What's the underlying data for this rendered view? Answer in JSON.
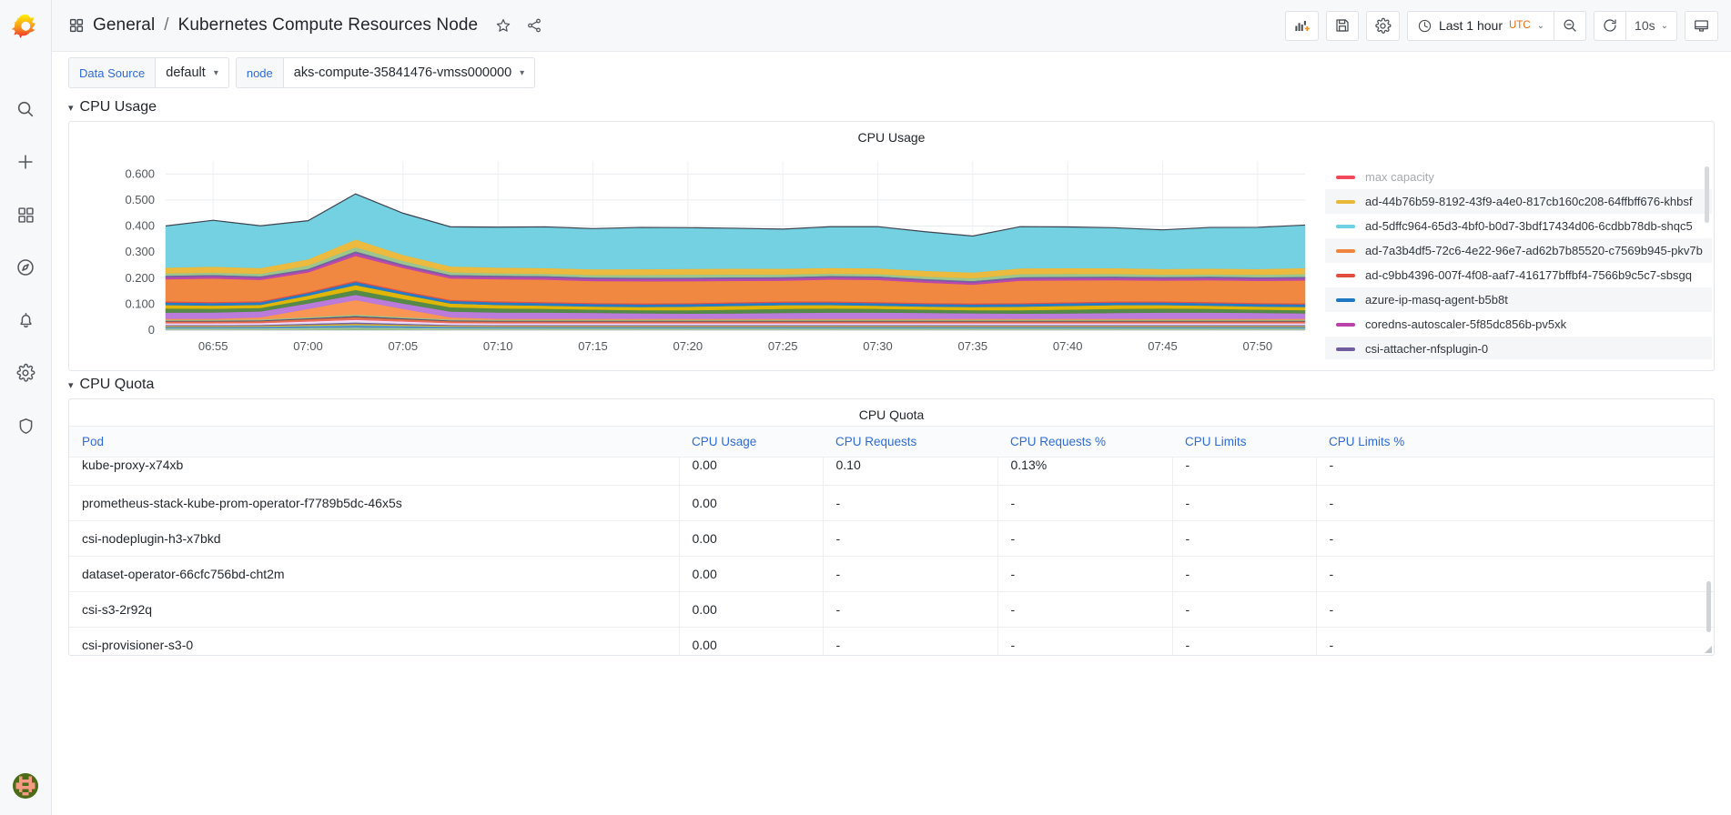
{
  "brand": {
    "icon": "grafana-logo-icon"
  },
  "sidebar": {
    "items": [
      {
        "name": "search",
        "icon": "search-icon",
        "label": "Search"
      },
      {
        "name": "create",
        "icon": "plus-icon",
        "label": "Create"
      },
      {
        "name": "dashboards",
        "icon": "dashboards-grid-icon",
        "label": "Dashboards"
      },
      {
        "name": "explore",
        "icon": "compass-icon",
        "label": "Explore"
      },
      {
        "name": "alerting",
        "icon": "bell-icon",
        "label": "Alerting"
      },
      {
        "name": "configuration",
        "icon": "gear-icon",
        "label": "Configuration"
      },
      {
        "name": "server-admin",
        "icon": "shield-icon",
        "label": "Server Admin"
      }
    ],
    "avatar": {
      "name": "user-avatar",
      "label": "User profile"
    }
  },
  "navbar": {
    "dashboard_icon": "dashboard-grid-icon",
    "folder": "General",
    "separator": "/",
    "title": "Kubernetes Compute Resources Node",
    "star_icon": "star-outline-icon",
    "share_icon": "share-nodes-icon",
    "buttons": {
      "add_panel": "add-panel-icon",
      "save": "save-disk-icon",
      "settings": "gear-icon",
      "zoom_out": "zoom-out-magnifier-icon",
      "kiosk": "tv-monitor-icon"
    },
    "time_picker": {
      "clock_icon": "clock-icon",
      "range": "Last 1 hour",
      "timezone": "UTC",
      "caret": "⌄"
    },
    "refresh": {
      "icon": "refresh-circular-arrows-icon",
      "interval": "10s",
      "caret": "⌄"
    }
  },
  "variables": [
    {
      "label": "Data Source",
      "value": "default",
      "name": "datasource"
    },
    {
      "label": "node",
      "value": "aks-compute-35841476-vmss000000",
      "name": "node"
    }
  ],
  "rows": [
    {
      "title": "CPU Usage",
      "collapsed": false
    },
    {
      "title": "CPU Quota",
      "collapsed": false
    }
  ],
  "cpu_usage_panel": {
    "title": "CPU Usage",
    "legend_scrollbar": true
  },
  "cpu_quota_panel": {
    "title": "CPU Quota",
    "columns": [
      "Pod",
      "CPU Usage",
      "CPU Requests",
      "CPU Requests %",
      "CPU Limits",
      "CPU Limits %"
    ],
    "rows": [
      {
        "pod": "kube-proxy-x74xb",
        "cpu_usage": "0.00",
        "cpu_requests": "0.10",
        "cpu_requests_pct": "0.13%",
        "cpu_limits": "-",
        "cpu_limits_pct": "-",
        "clipped": true
      },
      {
        "pod": "prometheus-stack-kube-prom-operator-f7789b5dc-46x5s",
        "cpu_usage": "0.00",
        "cpu_requests": "-",
        "cpu_requests_pct": "-",
        "cpu_limits": "-",
        "cpu_limits_pct": "-"
      },
      {
        "pod": "csi-nodeplugin-h3-x7bkd",
        "cpu_usage": "0.00",
        "cpu_requests": "-",
        "cpu_requests_pct": "-",
        "cpu_limits": "-",
        "cpu_limits_pct": "-"
      },
      {
        "pod": "dataset-operator-66cfc756bd-cht2m",
        "cpu_usage": "0.00",
        "cpu_requests": "-",
        "cpu_requests_pct": "-",
        "cpu_limits": "-",
        "cpu_limits_pct": "-"
      },
      {
        "pod": "csi-s3-2r92q",
        "cpu_usage": "0.00",
        "cpu_requests": "-",
        "cpu_requests_pct": "-",
        "cpu_limits": "-",
        "cpu_limits_pct": "-"
      },
      {
        "pod": "csi-provisioner-s3-0",
        "cpu_usage": "0.00",
        "cpu_requests": "-",
        "cpu_requests_pct": "-",
        "cpu_limits": "-",
        "cpu_limits_pct": "-"
      }
    ]
  },
  "chart_data": {
    "type": "area",
    "title": "CPU Usage",
    "stacked": true,
    "xlabel": "",
    "ylabel": "",
    "ylim": [
      0,
      0.65
    ],
    "yticks": [
      "0",
      "0.100",
      "0.200",
      "0.300",
      "0.400",
      "0.500",
      "0.600"
    ],
    "ytick_values": [
      0,
      0.1,
      0.2,
      0.3,
      0.4,
      0.5,
      0.6
    ],
    "xticks": [
      "06:55",
      "07:00",
      "07:05",
      "07:10",
      "07:15",
      "07:20",
      "07:25",
      "07:30",
      "07:35",
      "07:40",
      "07:45",
      "07:50"
    ],
    "grid": true,
    "legend_position": "right",
    "x": [
      0,
      1,
      2,
      3,
      4,
      5,
      6,
      7,
      8,
      9,
      10,
      11,
      12,
      13,
      14,
      15,
      16,
      17,
      18,
      19,
      20,
      21,
      22,
      23,
      24
    ],
    "series": [
      {
        "name": "max capacity",
        "color": "#f2495c",
        "values": [],
        "hidden": true
      },
      {
        "name": "ad-44b76b59-8192-43f9-a4e0-817cb160c208-64ffbff676-khbsf",
        "color": "#eab839",
        "values": [
          0.022,
          0.023,
          0.022,
          0.024,
          0.03,
          0.023,
          0.022,
          0.022,
          0.022,
          0.022,
          0.022,
          0.022,
          0.022,
          0.022,
          0.022,
          0.022,
          0.022,
          0.022,
          0.022,
          0.022,
          0.022,
          0.022,
          0.022,
          0.022,
          0.023
        ]
      },
      {
        "name": "ad-5dffc964-65d3-4bf0-b0d7-3bdf17434d06-6cdbb78db-shqc5",
        "color": "#6ed0e0",
        "values": [
          0.16,
          0.178,
          0.162,
          0.148,
          0.175,
          0.16,
          0.152,
          0.155,
          0.158,
          0.156,
          0.16,
          0.158,
          0.155,
          0.152,
          0.158,
          0.16,
          0.15,
          0.14,
          0.16,
          0.158,
          0.155,
          0.15,
          0.158,
          0.16,
          0.165
        ]
      },
      {
        "name": "ad-7a3b4df5-72c6-4e22-96e7-ad62b7b85520-c7569b945-pkv7b",
        "color": "#ef843c",
        "values": [
          0.085,
          0.09,
          0.082,
          0.075,
          0.095,
          0.088,
          0.082,
          0.085,
          0.086,
          0.084,
          0.085,
          0.084,
          0.082,
          0.08,
          0.084,
          0.085,
          0.078,
          0.072,
          0.086,
          0.084,
          0.082,
          0.08,
          0.084,
          0.085,
          0.088
        ]
      },
      {
        "name": "ad-c9bb4396-007f-4f08-aaf7-416177bffbf4-7566b9c5c7-sbsgq",
        "color": "#e24d42",
        "values": [
          0.004,
          0.004,
          0.004,
          0.004,
          0.005,
          0.004,
          0.004,
          0.004,
          0.004,
          0.004,
          0.004,
          0.004,
          0.004,
          0.004,
          0.004,
          0.004,
          0.004,
          0.004,
          0.004,
          0.004,
          0.004,
          0.004,
          0.004,
          0.004,
          0.004
        ]
      },
      {
        "name": "azure-ip-masq-agent-b5b8t",
        "color": "#1f78c1",
        "values": [
          0.01,
          0.01,
          0.01,
          0.01,
          0.012,
          0.01,
          0.01,
          0.01,
          0.01,
          0.01,
          0.01,
          0.01,
          0.01,
          0.01,
          0.01,
          0.01,
          0.01,
          0.01,
          0.01,
          0.01,
          0.01,
          0.01,
          0.01,
          0.01,
          0.01
        ]
      },
      {
        "name": "coredns-autoscaler-5f85dc856b-pv5xk",
        "color": "#ba43a9",
        "values": [
          0.008,
          0.008,
          0.008,
          0.008,
          0.01,
          0.008,
          0.008,
          0.008,
          0.008,
          0.008,
          0.008,
          0.008,
          0.008,
          0.008,
          0.008,
          0.008,
          0.008,
          0.008,
          0.008,
          0.008,
          0.008,
          0.008,
          0.008,
          0.008,
          0.008
        ]
      },
      {
        "name": "csi-attacher-nfsplugin-0",
        "color": "#705da0",
        "values": [
          0.006,
          0.006,
          0.006,
          0.006,
          0.008,
          0.006,
          0.006,
          0.006,
          0.006,
          0.006,
          0.006,
          0.006,
          0.006,
          0.006,
          0.006,
          0.006,
          0.006,
          0.006,
          0.006,
          0.006,
          0.006,
          0.006,
          0.006,
          0.006,
          0.006
        ]
      }
    ],
    "stack_bands": [
      {
        "color": "#508642",
        "label": "band-green"
      },
      {
        "color": "#b877d9",
        "label": "band-purple"
      },
      {
        "color": "#f9934e",
        "label": "band-peach"
      },
      {
        "color": "#e0b400",
        "label": "band-gold"
      }
    ]
  }
}
